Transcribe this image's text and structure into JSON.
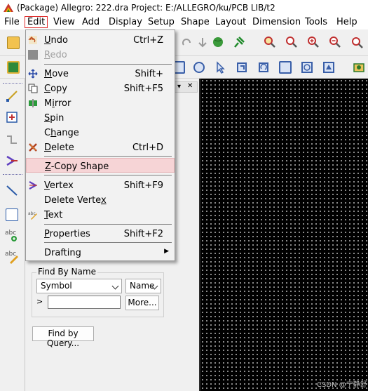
{
  "window": {
    "title": "(Package) Allegro: 222.dra  Project: E:/ALLEGRO/ku/PCB LIB/t2"
  },
  "menubar": {
    "items": [
      "File",
      "Edit",
      "View",
      "Add",
      "Display",
      "Setup",
      "Shape",
      "Layout",
      "Dimension",
      "Tools",
      "Help"
    ]
  },
  "edit_menu": {
    "items": [
      {
        "label": "Undo",
        "shortcut": "Ctrl+Z",
        "icon": "undo-icon",
        "enabled": true
      },
      {
        "label": "Redo",
        "shortcut": "",
        "icon": "redo-icon",
        "enabled": false
      },
      {
        "label": "Move",
        "shortcut": "Shift+",
        "icon": "move-icon",
        "enabled": true
      },
      {
        "label": "Copy",
        "shortcut": "Shift+F5",
        "icon": "copy-icon",
        "enabled": true
      },
      {
        "label": "Mirror",
        "shortcut": "",
        "icon": "mirror-icon",
        "enabled": true
      },
      {
        "label": "Spin",
        "shortcut": "",
        "icon": "",
        "enabled": true
      },
      {
        "label": "Change",
        "shortcut": "",
        "icon": "",
        "enabled": true
      },
      {
        "label": "Delete",
        "shortcut": "Ctrl+D",
        "icon": "delete-icon",
        "enabled": true
      },
      {
        "label": "Z-Copy Shape",
        "shortcut": "",
        "icon": "",
        "enabled": true,
        "highlighted": true
      },
      {
        "label": "Vertex",
        "shortcut": "Shift+F9",
        "icon": "vertex-icon",
        "enabled": true
      },
      {
        "label": "Delete Vertex",
        "shortcut": "",
        "icon": "",
        "enabled": true
      },
      {
        "label": "Text",
        "shortcut": "",
        "icon": "text-edit-icon",
        "enabled": true
      },
      {
        "label": "Properties",
        "shortcut": "Shift+F2",
        "icon": "",
        "enabled": true
      },
      {
        "label": "Drafting",
        "shortcut": "",
        "icon": "",
        "enabled": true,
        "submenu": true
      }
    ]
  },
  "find_panel": {
    "group_label": "Find By Name",
    "type_select": "Symbol",
    "field_select": "Name",
    "name_value": "",
    "more_button": "More...",
    "query_button": "Find by Query..."
  },
  "watermark": "CSDN @宁静舒",
  "colors": {
    "canvas_bg": "#000000",
    "grid_dot": "#b8b8b8",
    "menu_highlight": "#f6d4d6",
    "menu_focus_border": "#e03030"
  }
}
